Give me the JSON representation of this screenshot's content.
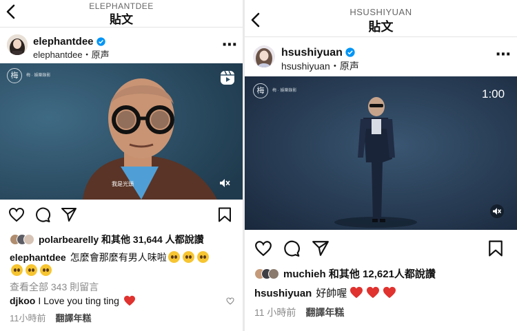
{
  "left": {
    "header_handle": "ELEPHANTDEE",
    "header_title": "貼文",
    "username": "elephantdee",
    "audio_label": "elephantdee・原声",
    "video_logo_line1": "梅",
    "video_logo_text": "梅 · 娛樂錄影",
    "video_subtitle": "我是光頭",
    "likes_user": "polarbearelly",
    "likes_text": "和其他 31,644 人都說讚",
    "caption_user": "elephantdee",
    "caption_text": "怎麼會那麼有男人味啦",
    "view_comments": "查看全部 343 則留言",
    "comment_user": "djkoo",
    "comment_text": "I Love you ting ting",
    "time": "11小時前",
    "translate": "翻譯年糕"
  },
  "right": {
    "header_handle": "HSUSHIYUAN",
    "header_title": "貼文",
    "username": "hsushiyuan",
    "audio_label": "hsushiyuan・原声",
    "video_logo_line1": "梅",
    "video_logo_text": "梅 · 娛樂錄影",
    "video_timer": "1:00",
    "likes_user": "muchieh",
    "likes_text": "和其他 12,621人都說讚",
    "caption_user": "hsushiyuan",
    "caption_text": "好帥喔",
    "time": "11 小時前",
    "translate": "翻譯年糕"
  },
  "colors": {
    "verified": "#0095f6",
    "heart": "#e0322f",
    "video_left_bg": "#2e4f64",
    "video_right_bg": "#27394f"
  },
  "icons": [
    "chevron-left-icon",
    "verified-badge-icon",
    "more-icon",
    "reels-icon",
    "mute-icon",
    "heart-icon",
    "comment-icon",
    "share-icon",
    "bookmark-icon",
    "heart-outline-small-icon"
  ]
}
